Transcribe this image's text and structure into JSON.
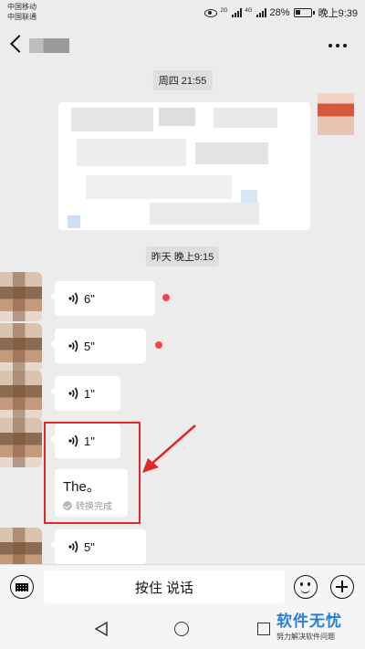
{
  "status_bar": {
    "carrier_1": "中国移动",
    "carrier_2": "中国联通",
    "net_1": "2G",
    "net_2": "4G",
    "battery": "28%",
    "time": "晚上9:39"
  },
  "chat": {
    "timestamps": [
      "周四 21:55",
      "昨天 晚上9:15"
    ],
    "voice_messages": [
      {
        "duration": "6\"",
        "unread": true
      },
      {
        "duration": "5\"",
        "unread": true
      },
      {
        "duration": "1\"",
        "unread": false
      },
      {
        "duration": "1\"",
        "unread": false
      },
      {
        "duration": "5\"",
        "unread": false
      }
    ],
    "transcript": {
      "text": "The。",
      "status": "转换完成"
    }
  },
  "input_bar": {
    "hold_to_talk": "按住 说话"
  },
  "watermark": {
    "title": "软件无忧",
    "subtitle": "努力解决软件问题"
  },
  "colors": {
    "unread_dot": "#f0454a",
    "highlight": "#e02828",
    "watermark": "#2a7fd4"
  }
}
